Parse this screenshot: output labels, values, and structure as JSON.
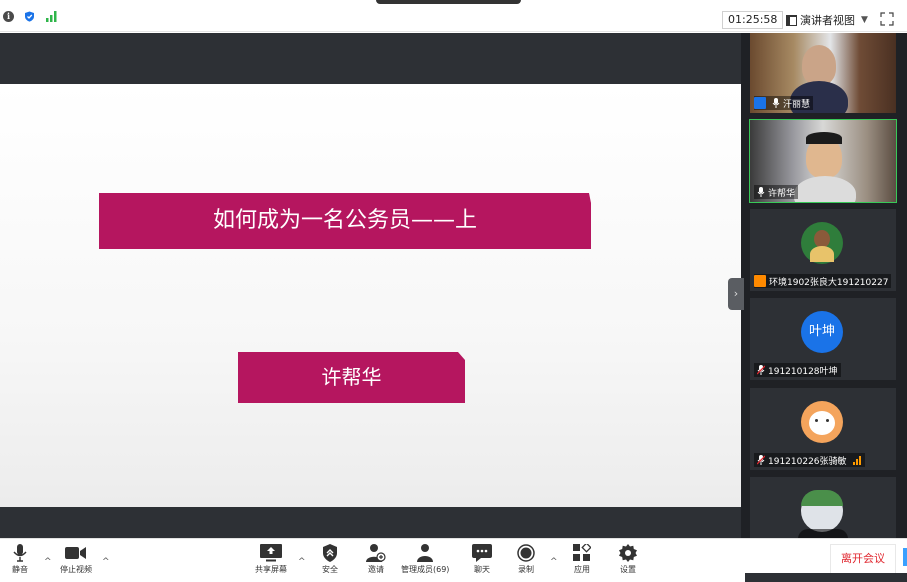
{
  "topbar": {
    "time": "01:25:58",
    "view_mode": "演讲者视图",
    "view_caret": "▼"
  },
  "slide": {
    "title": "如何成为一名公务员——上",
    "presenter": "许帮华"
  },
  "panel": {
    "collapse_glyph": "›",
    "participants": [
      {
        "name": "汗丽慧",
        "type": "video"
      },
      {
        "name": "许帮华",
        "type": "video"
      },
      {
        "name": "环境1902张良大191210227",
        "type": "avatar",
        "avatar_color": "#2f7d3b"
      },
      {
        "name": "191210128叶坤",
        "type": "avatar",
        "avatar_text": "叶坤",
        "avatar_color": "#1a73e8"
      },
      {
        "name": "191210226张骑敏",
        "type": "avatar",
        "avatar_color": "#f4a45c"
      }
    ]
  },
  "toolbar": {
    "mute": "静音",
    "stop_video": "停止视频",
    "share_screen": "共享屏幕",
    "security": "安全",
    "invite": "邀请",
    "manage_members": "管理成员(69)",
    "chat": "聊天",
    "record": "录制",
    "apps": "应用",
    "settings": "设置",
    "leave": "离开会议",
    "caret": "^"
  },
  "colors": {
    "slide_box": "#b5165f",
    "panel_bg": "#1f2125",
    "stage_bg": "#2d3035",
    "leave_text": "#e0262e",
    "active_speaker": "#38c958",
    "avatar_blue": "#1a73e8"
  }
}
